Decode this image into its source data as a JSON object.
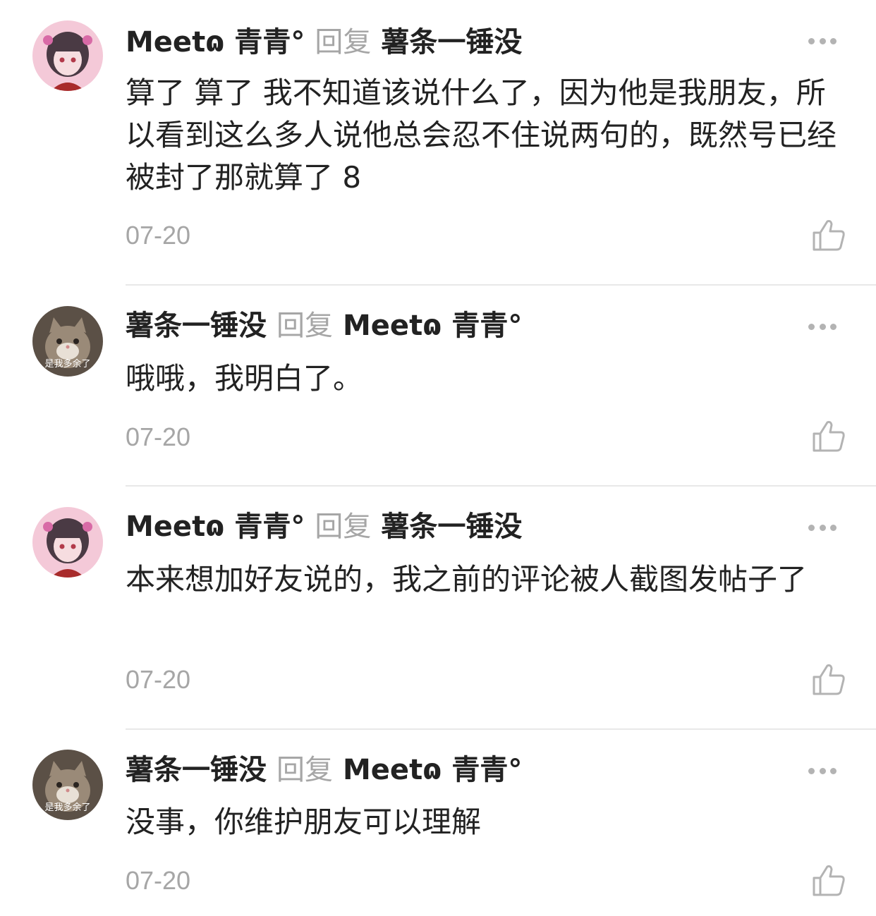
{
  "reply_word": "回复",
  "comments": [
    {
      "author": "Meetɷ 青青°",
      "reply_to": "薯条一锤没",
      "avatar_icon": "anime-girl-avatar",
      "text": "算了  算了  我不知道该说什么了，因为他是我朋友，所以看到这么多人说他总会忍不住说两句的，既然号已经被封了那就算了 8",
      "date": "07-20"
    },
    {
      "author": "薯条一锤没",
      "reply_to": "Meetɷ 青青°",
      "avatar_icon": "cat-avatar",
      "avatar_caption": "是我多余了",
      "text": "哦哦，我明白了。",
      "date": "07-20"
    },
    {
      "author": "Meetɷ 青青°",
      "reply_to": "薯条一锤没",
      "avatar_icon": "anime-girl-avatar",
      "text": "本来想加好友说的，我之前的评论被人截图发帖子了",
      "date": "07-20"
    },
    {
      "author": "薯条一锤没",
      "reply_to": "Meetɷ 青青°",
      "avatar_icon": "cat-avatar",
      "avatar_caption": "是我多余了",
      "text": "没事，你维护朋友可以理解",
      "date": "07-20"
    }
  ],
  "colors": {
    "primary_text": "#222222",
    "secondary_text": "#a6a6a6",
    "divider": "#e8e8e8",
    "icon_gray": "#b3b3b3"
  }
}
